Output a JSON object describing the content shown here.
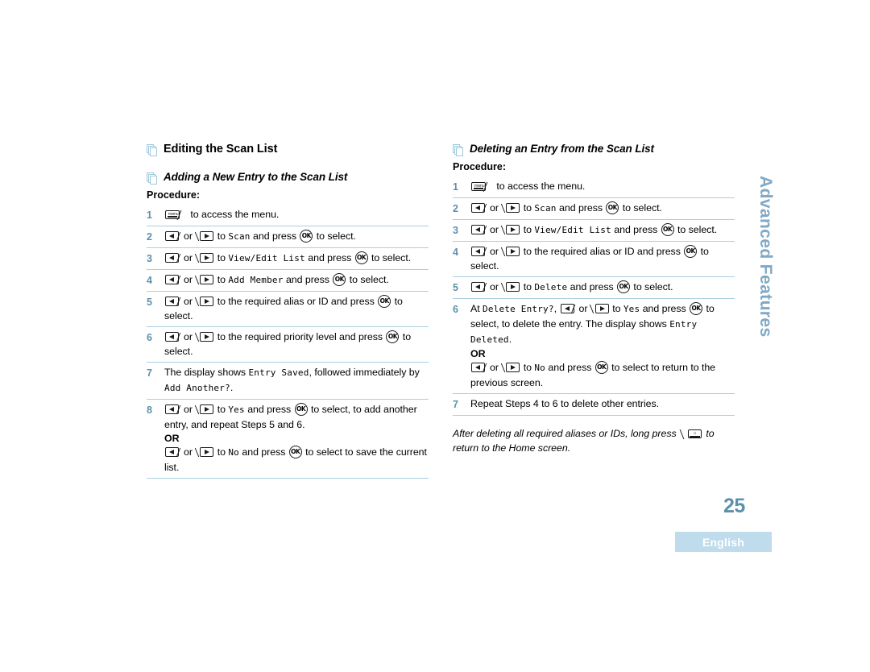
{
  "page": {
    "number": "25",
    "language_badge": "English",
    "side_tab": "Advanced Features"
  },
  "left_column": {
    "heading": "Editing the Scan List",
    "subheading": "Adding a New Entry to the Scan List",
    "procedure_label": "Procedure:",
    "steps": [
      {
        "num": "1",
        "parts": [
          {
            "type": "key",
            "icon": "menu-key-icon"
          },
          {
            "type": "text",
            "text": " to access the menu."
          }
        ]
      },
      {
        "num": "2",
        "parts": [
          {
            "type": "key",
            "icon": "left-arrow-key-icon"
          },
          {
            "type": "text",
            "text": "or "
          },
          {
            "type": "key",
            "icon": "right-arrow-key-icon"
          },
          {
            "type": "text",
            "text": " to "
          },
          {
            "type": "lcd",
            "text": "Scan"
          },
          {
            "type": "text",
            "text": " and press "
          },
          {
            "type": "key",
            "icon": "ok-key-icon"
          },
          {
            "type": "text",
            "text": " to select."
          }
        ]
      },
      {
        "num": "3",
        "parts": [
          {
            "type": "key",
            "icon": "left-arrow-key-icon"
          },
          {
            "type": "text",
            "text": "or "
          },
          {
            "type": "key",
            "icon": "right-arrow-key-icon"
          },
          {
            "type": "text",
            "text": " to "
          },
          {
            "type": "lcd",
            "text": "View/Edit List"
          },
          {
            "type": "text",
            "text": " and press "
          },
          {
            "type": "key",
            "icon": "ok-key-icon"
          },
          {
            "type": "text",
            "text": " to select."
          }
        ]
      },
      {
        "num": "4",
        "parts": [
          {
            "type": "key",
            "icon": "left-arrow-key-icon"
          },
          {
            "type": "text",
            "text": "or "
          },
          {
            "type": "key",
            "icon": "right-arrow-key-icon"
          },
          {
            "type": "text",
            "text": " to "
          },
          {
            "type": "lcd",
            "text": "Add Member"
          },
          {
            "type": "text",
            "text": " and press "
          },
          {
            "type": "key",
            "icon": "ok-key-icon"
          },
          {
            "type": "text",
            "text": " to select."
          }
        ]
      },
      {
        "num": "5",
        "parts": [
          {
            "type": "key",
            "icon": "left-arrow-key-icon"
          },
          {
            "type": "text",
            "text": "or "
          },
          {
            "type": "key",
            "icon": "right-arrow-key-icon"
          },
          {
            "type": "text",
            "text": " to the required alias or ID and press "
          },
          {
            "type": "key",
            "icon": "ok-key-icon"
          },
          {
            "type": "text",
            "text": " to select."
          }
        ]
      },
      {
        "num": "6",
        "parts": [
          {
            "type": "key",
            "icon": "left-arrow-key-icon"
          },
          {
            "type": "text",
            "text": "or "
          },
          {
            "type": "key",
            "icon": "right-arrow-key-icon"
          },
          {
            "type": "text",
            "text": " to the required priority level and press "
          },
          {
            "type": "key",
            "icon": "ok-key-icon"
          },
          {
            "type": "text",
            "text": " to select."
          }
        ]
      },
      {
        "num": "7",
        "parts": [
          {
            "type": "text",
            "text": "The display shows "
          },
          {
            "type": "lcd",
            "text": "Entry Saved"
          },
          {
            "type": "text",
            "text": ", followed immediately by "
          },
          {
            "type": "lcd",
            "text": "Add Another?"
          },
          {
            "type": "text",
            "text": "."
          }
        ]
      },
      {
        "num": "8",
        "parts": [
          {
            "type": "key",
            "icon": "left-arrow-key-icon"
          },
          {
            "type": "text",
            "text": "or "
          },
          {
            "type": "key",
            "icon": "right-arrow-key-icon"
          },
          {
            "type": "text",
            "text": " to "
          },
          {
            "type": "lcd",
            "text": "Yes"
          },
          {
            "type": "text",
            "text": " and press "
          },
          {
            "type": "key",
            "icon": "ok-key-icon"
          },
          {
            "type": "text",
            "text": " to select, to add another entry, and repeat Steps 5 and 6."
          },
          {
            "type": "or",
            "text": "OR"
          },
          {
            "type": "key",
            "icon": "left-arrow-key-icon"
          },
          {
            "type": "text",
            "text": "or "
          },
          {
            "type": "key",
            "icon": "right-arrow-key-icon"
          },
          {
            "type": "text",
            "text": " to "
          },
          {
            "type": "lcd",
            "text": "No"
          },
          {
            "type": "text",
            "text": " and press "
          },
          {
            "type": "key",
            "icon": "ok-key-icon"
          },
          {
            "type": "text",
            "text": " to select to save the current list."
          }
        ]
      }
    ]
  },
  "right_column": {
    "subheading": "Deleting an Entry from the Scan List",
    "procedure_label": "Procedure:",
    "steps": [
      {
        "num": "1",
        "parts": [
          {
            "type": "key",
            "icon": "menu-key-icon"
          },
          {
            "type": "text",
            "text": " to access the menu."
          }
        ]
      },
      {
        "num": "2",
        "parts": [
          {
            "type": "key",
            "icon": "left-arrow-key-icon"
          },
          {
            "type": "text",
            "text": "or "
          },
          {
            "type": "key",
            "icon": "right-arrow-key-icon"
          },
          {
            "type": "text",
            "text": " to "
          },
          {
            "type": "lcd",
            "text": "Scan"
          },
          {
            "type": "text",
            "text": " and press "
          },
          {
            "type": "key",
            "icon": "ok-key-icon"
          },
          {
            "type": "text",
            "text": " to select."
          }
        ]
      },
      {
        "num": "3",
        "parts": [
          {
            "type": "key",
            "icon": "left-arrow-key-icon"
          },
          {
            "type": "text",
            "text": "or "
          },
          {
            "type": "key",
            "icon": "right-arrow-key-icon"
          },
          {
            "type": "text",
            "text": " to "
          },
          {
            "type": "lcd",
            "text": "View/Edit List"
          },
          {
            "type": "text",
            "text": " and press "
          },
          {
            "type": "key",
            "icon": "ok-key-icon"
          },
          {
            "type": "text",
            "text": " to select."
          }
        ]
      },
      {
        "num": "4",
        "parts": [
          {
            "type": "key",
            "icon": "left-arrow-key-icon"
          },
          {
            "type": "text",
            "text": "or "
          },
          {
            "type": "key",
            "icon": "right-arrow-key-icon"
          },
          {
            "type": "text",
            "text": " to the required alias or ID and press "
          },
          {
            "type": "key",
            "icon": "ok-key-icon"
          },
          {
            "type": "text",
            "text": " to select."
          }
        ]
      },
      {
        "num": "5",
        "parts": [
          {
            "type": "key",
            "icon": "left-arrow-key-icon"
          },
          {
            "type": "text",
            "text": "or "
          },
          {
            "type": "key",
            "icon": "right-arrow-key-icon"
          },
          {
            "type": "text",
            "text": " to "
          },
          {
            "type": "lcd",
            "text": "Delete"
          },
          {
            "type": "text",
            "text": " and press "
          },
          {
            "type": "key",
            "icon": "ok-key-icon"
          },
          {
            "type": "text",
            "text": " to select."
          }
        ]
      },
      {
        "num": "6",
        "parts": [
          {
            "type": "text",
            "text": "At "
          },
          {
            "type": "lcd",
            "text": "Delete Entry?"
          },
          {
            "type": "text",
            "text": ", "
          },
          {
            "type": "key",
            "icon": "left-arrow-key-icon"
          },
          {
            "type": "text",
            "text": "or "
          },
          {
            "type": "key",
            "icon": "right-arrow-key-icon"
          },
          {
            "type": "text",
            "text": " to "
          },
          {
            "type": "lcd",
            "text": "Yes"
          },
          {
            "type": "text",
            "text": " and press "
          },
          {
            "type": "key",
            "icon": "ok-key-icon"
          },
          {
            "type": "text",
            "text": " to select, to delete the entry. The display shows "
          },
          {
            "type": "lcd",
            "text": "Entry Deleted"
          },
          {
            "type": "text",
            "text": "."
          },
          {
            "type": "or",
            "text": "OR"
          },
          {
            "type": "key",
            "icon": "left-arrow-key-icon"
          },
          {
            "type": "text",
            "text": "or "
          },
          {
            "type": "key",
            "icon": "right-arrow-key-icon"
          },
          {
            "type": "text",
            "text": " to "
          },
          {
            "type": "lcd",
            "text": "No"
          },
          {
            "type": "text",
            "text": " and press "
          },
          {
            "type": "key",
            "icon": "ok-key-icon"
          },
          {
            "type": "text",
            "text": " to select to return to the previous screen."
          }
        ]
      },
      {
        "num": "7",
        "parts": [
          {
            "type": "text",
            "text": "Repeat Steps 4 to 6 to delete other entries."
          }
        ]
      }
    ],
    "note_parts": [
      {
        "type": "text",
        "text": "After deleting all required aliases or IDs, long press "
      },
      {
        "type": "key",
        "icon": "home-key-icon"
      },
      {
        "type": "text",
        "text": " to return to the Home screen."
      }
    ]
  },
  "colors": {
    "accent_blue": "#5c90ab",
    "rule_blue": "#a9cfe0",
    "tab_blue": "#7fa9c4",
    "badge_blue": "#bfdced"
  }
}
